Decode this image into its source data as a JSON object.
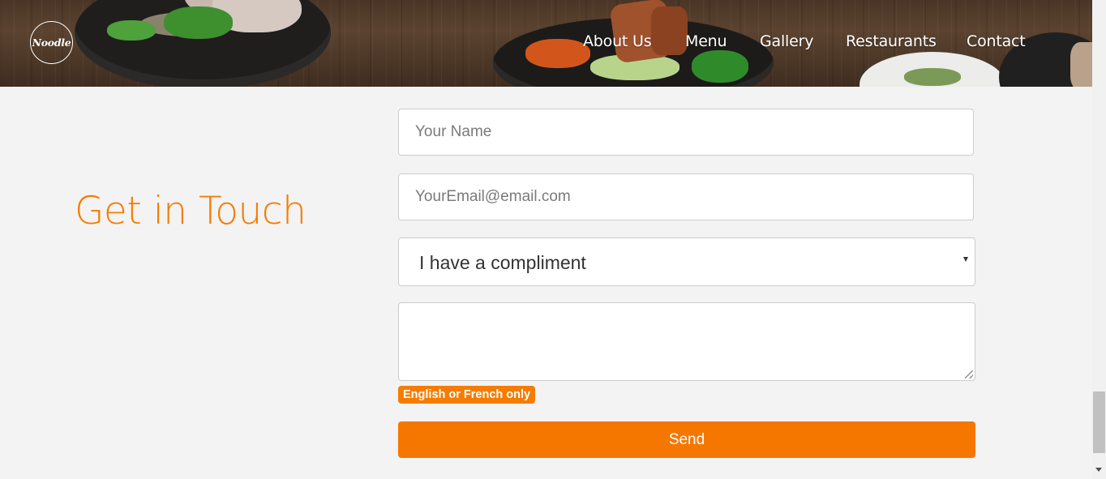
{
  "header": {
    "logo_text": "Noodle",
    "nav": [
      {
        "label": "About Us"
      },
      {
        "label": "Menu"
      },
      {
        "label": "Gallery"
      },
      {
        "label": "Restaurants"
      },
      {
        "label": "Contact"
      }
    ]
  },
  "main": {
    "heading": "Get in Touch"
  },
  "form": {
    "name_placeholder": "Your Name",
    "email_placeholder": "YourEmail@email.com",
    "topic_selected": "I have a compliment",
    "message_value": "",
    "language_note": "English or French only",
    "send_label": "Send"
  },
  "colors": {
    "accent": "#f57c00",
    "button": "#f57700",
    "page_bg": "#f3f3f3"
  },
  "icons": {
    "select_arrow": "caret-down-icon",
    "scroll_down": "scroll-down-arrow-icon"
  }
}
